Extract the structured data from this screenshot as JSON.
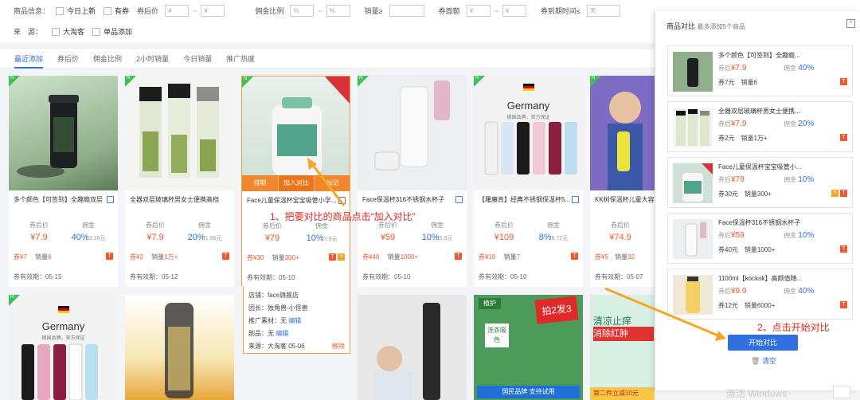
{
  "filters": {
    "row1": {
      "label": "商品信息：",
      "opt1": "今日上新",
      "opt2": "有券",
      "price_label": "券后价",
      "yen": "¥",
      "commission_label": "佣金比例",
      "pct": "%",
      "sales_label": "销量≥",
      "coupon_label": "券面额",
      "expire_label": "券到期时间≤",
      "day": "天",
      "tilde": "~"
    },
    "row2": {
      "label": "来　源：",
      "opt1": "大淘客",
      "opt2": "单品添加"
    }
  },
  "tabs": [
    "最近添加",
    "券后价",
    "佣金比例",
    "2小时销量",
    "今日销量",
    "推广热度"
  ],
  "cards": [
    {
      "title": "多个颜色【可签到】全趣瘾双层",
      "price_label": "券后价",
      "price": "¥7.9",
      "comm_label": "佣金",
      "comm": "40%",
      "comm_amt": "3.16元",
      "coupon": "券¥7",
      "sales_label": "销量",
      "sales": "6",
      "expiry": "券有效期：05-15",
      "new": "N"
    },
    {
      "title": "全器双层玻璃杯男女士便携高档",
      "price_label": "券后价",
      "price": "¥7.9",
      "comm_label": "佣金",
      "comm": "20%",
      "comm_amt": "1.58元",
      "coupon": "券¥2",
      "sales_label": "销量",
      "sales": "1万+",
      "expiry": "券有效期：05-12",
      "new": "N"
    },
    {
      "title": "Face儿童保温杯宝宝吸管小学...",
      "price_label": "券后价",
      "price": "¥79",
      "comm_label": "佣金",
      "comm": "10%",
      "comm_amt": "7.9元",
      "coupon": "券¥30",
      "sales_label": "销量",
      "sales": "300+",
      "expiry": "券有效期：05-10",
      "new": "N"
    },
    {
      "title": "Face保温杯316不锈钢水杯子",
      "price_label": "券后价",
      "price": "¥59",
      "comm_label": "佣金",
      "comm": "10%",
      "comm_amt": "5.9元",
      "coupon": "券¥40",
      "sales_label": "销量",
      "sales": "1000+",
      "expiry": "券有效期：05-10",
      "new": "N"
    },
    {
      "title": "【羅魔肯】经典不锈钢保温杯5...",
      "price_label": "券后价",
      "price": "¥109",
      "comm_label": "佣金",
      "comm": "8%",
      "comm_amt": "8.72元",
      "coupon": "券¥10",
      "sales_label": "销量",
      "sales": "7",
      "expiry": "券有效期：05-10",
      "new": "N"
    },
    {
      "title": "KK树保温杯儿童大容量",
      "price_label": "券后价",
      "price": "¥74.9",
      "comm_label": "佣金",
      "comm": "",
      "comm_amt": "",
      "coupon": "券¥5",
      "sales_label": "销量",
      "sales": "32",
      "expiry": "券有效期：05-07",
      "new": "N"
    }
  ],
  "selected_overlay": [
    "排期",
    "加入对比",
    "标记"
  ],
  "selected_extra": {
    "shop": "店铺：face旗舰店",
    "team": "团长：独角兽-小怪兽",
    "material_label": "推广素材：无",
    "edit": "编辑",
    "strategy_label": "剧品：无",
    "source": "来源：大淘客 05-06",
    "remove": "移除"
  },
  "germany_text": "Germany",
  "germany_sub": "德国品牌，官方保证",
  "panel": {
    "title": "商品对比",
    "subtitle": "最多添加5个商品",
    "collapse": "^",
    "items": [
      {
        "name": "多个颜色【可签到】全趣瘾...",
        "price_label": "券后",
        "price": "¥7.9",
        "comm_label": "佣金",
        "comm": "40%",
        "coupon": "券7元",
        "sales": "销量6"
      },
      {
        "name": "全器双层玻璃杯男女士便携...",
        "price_label": "券后",
        "price": "¥7.9",
        "comm_label": "佣金",
        "comm": "20%",
        "coupon": "券2元",
        "sales": "销量1万+"
      },
      {
        "name": "Face儿童保温杯宝宝吸管小...",
        "price_label": "券后",
        "price": "¥79",
        "comm_label": "佣金",
        "comm": "10%",
        "coupon": "券30元",
        "sales": "销量300+"
      },
      {
        "name": "Face保温杯316不锈钢水杯子",
        "price_label": "券后",
        "price": "¥59",
        "comm_label": "佣金",
        "comm": "10%",
        "coupon": "券40元",
        "sales": "销量1000+"
      },
      {
        "name": "1100ml【kockok】高颜值随...",
        "price_label": "券后",
        "price": "¥9.9",
        "comm_label": "佣金",
        "comm": "40%",
        "coupon": "券12元",
        "sales": "销量6000+"
      }
    ],
    "start": "开始对比",
    "clear": "清空"
  },
  "annotations": {
    "a1": "1、把要对比的商品点击“加入对比”",
    "a2": "2、点击开始对比"
  },
  "watermark": "激活 Windows",
  "promo": {
    "p1": "拍2发3",
    "p2": "清凉止痒",
    "p3": "消除红肿",
    "p4": "国民品牌 支持试用",
    "p5": "第二件立减10元",
    "p6": "植护",
    "p7": "洗衣吸色"
  },
  "marks": {
    "t": "T",
    "y": "Y"
  },
  "colors": {
    "accent": "#2f6fde",
    "price": "#f2562c",
    "annotation": "#e0271f",
    "arrow": "#f5a623"
  }
}
